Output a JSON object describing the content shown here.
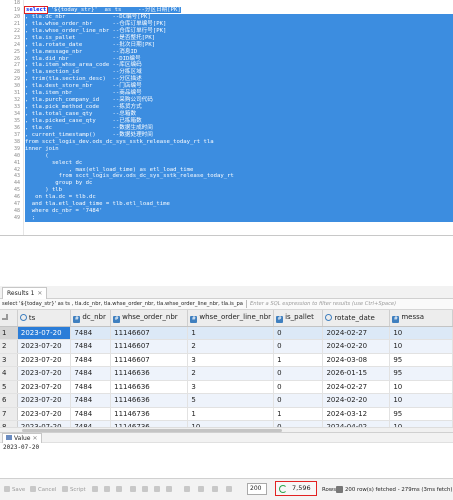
{
  "editor": {
    "line_numbers": [
      "18",
      "19",
      "20",
      "21",
      "22",
      "23",
      "24",
      "25",
      "26",
      "27",
      "28",
      "29",
      "30",
      "31",
      "32",
      "33",
      "34",
      "35",
      "36",
      "37",
      "38",
      "39",
      "40",
      "41",
      "42",
      "43",
      "44",
      "45",
      "46",
      "47",
      "48",
      "49"
    ],
    "lines": [
      {
        "text": "",
        "sel": false
      },
      {
        "kw": "select",
        "rest": " '${today_str}'  as ts     --分区日期[PK]",
        "sel": true,
        "partial": true
      },
      {
        "text": ", tla.dc_nbr              --DC编号[PK]",
        "sel": true
      },
      {
        "text": ", tla.whse_order_nbr      --仓库订单编号[PK]",
        "sel": true
      },
      {
        "text": ", tla.whse_order_line_nbr --仓库订单行号[PK]",
        "sel": true
      },
      {
        "text": ", tla.is_pallet           --是否整托[PK]",
        "sel": true
      },
      {
        "text": ", tla.rotate_date         --批次日期[PK]",
        "sel": true
      },
      {
        "text": ", tla.message_nbr         --消息ID",
        "sel": true
      },
      {
        "text": ", tla.did_nbr             --DID编号",
        "sel": true
      },
      {
        "text": ", tla.item_whse_area_code --库区编码",
        "sel": true
      },
      {
        "text": ", tla.section_id          --分拣区域",
        "sel": true
      },
      {
        "text": ", trim(tla.section_desc)  --分区描述",
        "sel": true
      },
      {
        "text": ", tla.dest_store_nbr      --门店编号",
        "sel": true
      },
      {
        "text": ", tla.item_nbr            --商品编号",
        "sel": true
      },
      {
        "text": ", tla.purch_company_id    --采购公司代码",
        "sel": true
      },
      {
        "text": ", tla.pick_method_code    --拣货方式",
        "sel": true
      },
      {
        "text": ", tla.total_case_qty      --总箱数",
        "sel": true
      },
      {
        "text": ", tla.picked_case_qty     --已拣箱数",
        "sel": true
      },
      {
        "text": ", tla.dc                  --数据生成时间",
        "sel": true
      },
      {
        "text": ", current_timestamp()     --数据处理时间",
        "sel": true
      },
      {
        "text": "from scct_logis_dev.ods_dc_sys_sstk_release_today_rt tla",
        "sel": true
      },
      {
        "text": "inner join",
        "sel": true
      },
      {
        "text": "      (",
        "sel": true
      },
      {
        "text": "        select dc",
        "sel": true
      },
      {
        "text": "             , max(etl_load_time) as etl_load_time",
        "sel": true
      },
      {
        "text": "          from scct_logis_dev.ods_dc_sys_sstk_release_today_rt",
        "sel": true
      },
      {
        "text": "         group by dc",
        "sel": true
      },
      {
        "text": "      ) tlb",
        "sel": true
      },
      {
        "text": "   on tla.dc = tlb.dc",
        "sel": true
      },
      {
        "text": "  and tla.etl_load_time = tlb.etl_load_time",
        "sel": true
      },
      {
        "text": "  where dc_nbr = '7484'",
        "sel": true
      },
      {
        "text": "  ;",
        "sel": true
      }
    ]
  },
  "results": {
    "tab_label": "Results 1",
    "filter_query": "select '${today_str}' as ts , tla.dc_nbr, tla.whse_order_nbr, tla.whse_order_line_nbr, tla.is_pa",
    "filter_placeholder": "Enter a SQL expression to filter results (use Ctrl+Space)",
    "columns": [
      "ts",
      "dc_nbr",
      "whse_order_nbr",
      "whse_order_line_nbr",
      "is_pallet",
      "rotate_date",
      "messa"
    ],
    "rows": [
      [
        "1",
        "2023-07-20",
        "7484",
        "11146607",
        "1",
        "0",
        "2024-02-27",
        "10"
      ],
      [
        "2",
        "2023-07-20",
        "7484",
        "11146607",
        "2",
        "0",
        "2024-02-20",
        "10"
      ],
      [
        "3",
        "2023-07-20",
        "7484",
        "11146607",
        "3",
        "1",
        "2024-03-08",
        "95"
      ],
      [
        "4",
        "2023-07-20",
        "7484",
        "11146636",
        "2",
        "0",
        "2026-01-15",
        "95"
      ],
      [
        "5",
        "2023-07-20",
        "7484",
        "11146636",
        "3",
        "0",
        "2024-02-27",
        "10"
      ],
      [
        "6",
        "2023-07-20",
        "7484",
        "11146636",
        "5",
        "0",
        "2024-02-20",
        "10"
      ],
      [
        "7",
        "2023-07-20",
        "7484",
        "11146736",
        "1",
        "1",
        "2024-03-12",
        "95"
      ],
      [
        "8",
        "2023-07-20",
        "7484",
        "11146736",
        "10",
        "0",
        "2024-04-02",
        "10"
      ]
    ]
  },
  "value_panel": {
    "tab_label": "Value",
    "content": "2023-07-20"
  },
  "toolbar": {
    "save": "Save",
    "cancel": "Cancel",
    "script": "Script",
    "limit": "200",
    "count": "7,596",
    "rows_label": "Rows: 1",
    "status": "200 row(s) fetched - 279ms (3ms fetch), on"
  },
  "colors": {
    "selection": "#3c8de0",
    "highlight_box": "#e22222",
    "active_cell": "#2b7dd8"
  }
}
